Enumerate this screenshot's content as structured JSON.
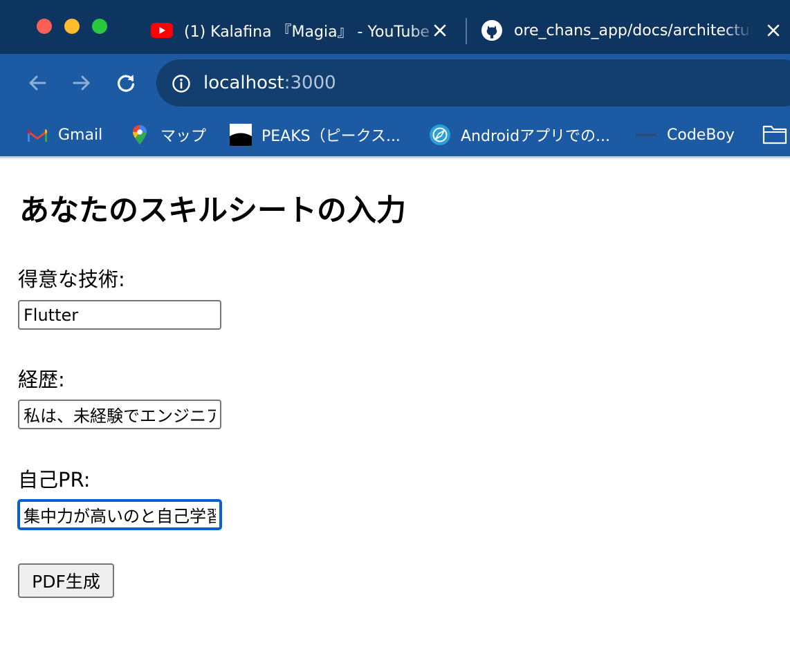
{
  "browser": {
    "tabs": [
      {
        "title": "(1) Kalafina 『Magia』 - YouTube",
        "favicon": "youtube-icon"
      },
      {
        "title": "ore_chans_app/docs/architecture",
        "favicon": "github-icon"
      }
    ],
    "address_bar": {
      "host": "localhost",
      "port": ":3000"
    },
    "bookmarks": [
      {
        "label": "Gmail",
        "icon": "gmail-icon"
      },
      {
        "label": "マップ",
        "icon": "google-maps-icon"
      },
      {
        "label": "PEAKS（ピークス...",
        "icon": "peaks-icon"
      },
      {
        "label": "Androidアプリでの...",
        "icon": "compass-icon"
      },
      {
        "label": "CodeBoy",
        "icon": "codeboy-icon"
      }
    ],
    "colors": {
      "tab_strip": "#0e3560",
      "toolbar": "#1c5aa3",
      "omnibox": "#133f70",
      "focus_ring": "#0b5fd6"
    }
  },
  "page": {
    "title": "あなたのスキルシートの入力",
    "fields": [
      {
        "label": "得意な技術:",
        "value": "Flutter"
      },
      {
        "label": "経歴:",
        "value": "私は、未経験でエンジニア"
      },
      {
        "label": "自己PR:",
        "value": "集中力が高いのと自己学習",
        "focused": true
      }
    ],
    "submit_label": "PDF生成"
  }
}
